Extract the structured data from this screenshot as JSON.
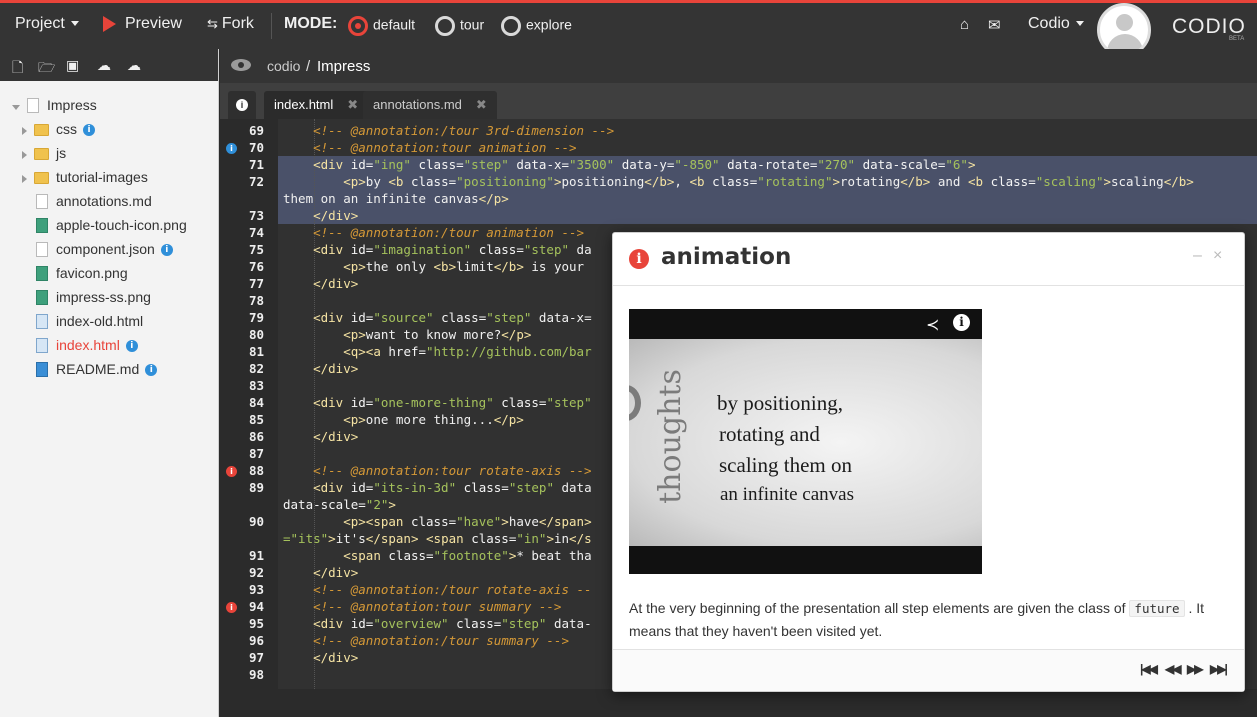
{
  "topbar": {
    "project": "Project",
    "preview": "Preview",
    "fork": "Fork",
    "mode_label": "MODE:",
    "modes": [
      "default",
      "tour",
      "explore"
    ],
    "selected_mode": "default",
    "user": "Codio",
    "logo": "CODIO",
    "logo_sub": "BETA"
  },
  "sidebar": {
    "tree": [
      {
        "label": "Impress",
        "type": "root"
      },
      {
        "label": "css",
        "type": "folder",
        "info": true
      },
      {
        "label": "js",
        "type": "folder"
      },
      {
        "label": "tutorial-images",
        "type": "folder"
      },
      {
        "label": "annotations.md",
        "type": "file"
      },
      {
        "label": "apple-touch-icon.png",
        "type": "png"
      },
      {
        "label": "component.json",
        "type": "file",
        "info": true
      },
      {
        "label": "favicon.png",
        "type": "png"
      },
      {
        "label": "impress-ss.png",
        "type": "png"
      },
      {
        "label": "index-old.html",
        "type": "doc"
      },
      {
        "label": "index.html",
        "type": "doc",
        "info": true,
        "active": true
      },
      {
        "label": "README.md",
        "type": "md",
        "info": true
      }
    ]
  },
  "breadcrumb": {
    "owner": "codio",
    "separator": "/",
    "project": "Impress"
  },
  "tabs": [
    {
      "label": "index.html",
      "active": true
    },
    {
      "label": "annotations.md",
      "active": false
    }
  ],
  "editor": {
    "line_numbers": [
      "69",
      "70",
      "71",
      "72",
      "73",
      "74",
      "75",
      "76",
      "77",
      "78",
      "79",
      "80",
      "81",
      "82",
      "83",
      "84",
      "85",
      "86",
      "87",
      "88",
      "89",
      "90",
      "91",
      "92",
      "93",
      "94",
      "95",
      "96",
      "97",
      "98"
    ]
  },
  "annotation_panel": {
    "title": "animation",
    "video_lines": [
      "by positioning,",
      "rotating and",
      "scaling them on",
      "an infinite canvas"
    ],
    "video_side_text": "thoughts",
    "description_before": "At the very beginning of the presentation all step elements are given the class of",
    "description_code": "future",
    "description_after": ". It means that they haven't been visited yet.",
    "minimize": "–",
    "close": "×"
  },
  "colors": {
    "accent": "#e8443a",
    "info": "#2f8fd9",
    "highlight": "#4a5169"
  }
}
